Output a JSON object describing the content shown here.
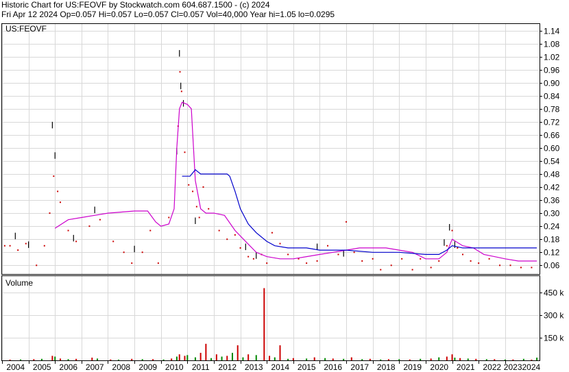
{
  "header": {
    "line1": "Historic Chart for US:FEOVF by Stockwatch.com 604.687.1500 - (c) 2024",
    "line2": "Fri Apr 12 2024   Op=0.057  Hi=0.057  Lo=0.057  Cl=0.057  Vol=40,000  Year hi=1.05  lo=0.0295"
  },
  "chart_data": [
    {
      "type": "line",
      "title": "US:FEOVF",
      "ylim": [
        0.02,
        1.17
      ],
      "y_ticks": [
        "1.14",
        "1.08",
        "1.02",
        "0.96",
        "0.90",
        "0.84",
        "0.78",
        "0.72",
        "0.66",
        "0.60",
        "0.54",
        "0.48",
        "0.42",
        "0.36",
        "0.30",
        "0.24",
        "0.18",
        "0.12",
        "0.06"
      ],
      "y_tick_values": [
        1.14,
        1.08,
        1.02,
        0.96,
        0.9,
        0.84,
        0.78,
        0.72,
        0.66,
        0.6,
        0.54,
        0.48,
        0.42,
        0.36,
        0.3,
        0.24,
        0.18,
        0.12,
        0.06
      ],
      "x_ticks": [
        "2004",
        "2005",
        "2006",
        "2007",
        "2008",
        "2009",
        "2010",
        "2011",
        "2012",
        "2013",
        "2014",
        "2015",
        "2016",
        "2017",
        "2018",
        "2019",
        "2020",
        "2021",
        "2022",
        "20232024"
      ],
      "xlim": [
        2004.0,
        2024.3
      ],
      "grid": true,
      "series": [
        {
          "color": "#000000",
          "style": "hi-lo bars",
          "points": [
            [
              2004.5,
              0.21
            ],
            [
              2005.0,
              0.17
            ],
            [
              2005.9,
              0.72
            ],
            [
              2006.0,
              0.58
            ],
            [
              2006.7,
              0.2
            ],
            [
              2007.5,
              0.33
            ],
            [
              2009.0,
              0.15
            ],
            [
              2010.6,
              0.6
            ],
            [
              2010.7,
              1.05
            ],
            [
              2010.75,
              0.9
            ],
            [
              2010.85,
              0.82
            ],
            [
              2011.3,
              0.28
            ],
            [
              2013.2,
              0.16
            ],
            [
              2013.6,
              0.12
            ],
            [
              2015.9,
              0.16
            ],
            [
              2016.9,
              0.13
            ],
            [
              2020.7,
              0.18
            ],
            [
              2020.9,
              0.25
            ],
            [
              2021.1,
              0.17
            ]
          ]
        },
        {
          "color": "#cc0000",
          "style": "close dots",
          "points": [
            [
              2004.1,
              0.15
            ],
            [
              2004.3,
              0.15
            ],
            [
              2004.6,
              0.13
            ],
            [
              2004.9,
              0.16
            ],
            [
              2005.3,
              0.06
            ],
            [
              2005.6,
              0.15
            ],
            [
              2005.8,
              0.3
            ],
            [
              2005.95,
              0.47
            ],
            [
              2006.1,
              0.4
            ],
            [
              2006.2,
              0.35
            ],
            [
              2006.5,
              0.22
            ],
            [
              2006.8,
              0.17
            ],
            [
              2007.3,
              0.24
            ],
            [
              2007.7,
              0.27
            ],
            [
              2008.2,
              0.17
            ],
            [
              2008.6,
              0.12
            ],
            [
              2008.9,
              0.07
            ],
            [
              2009.3,
              0.12
            ],
            [
              2009.6,
              0.22
            ],
            [
              2009.9,
              0.07
            ],
            [
              2010.3,
              0.28
            ],
            [
              2010.65,
              0.7
            ],
            [
              2010.72,
              0.95
            ],
            [
              2010.78,
              0.86
            ],
            [
              2010.9,
              0.58
            ],
            [
              2011.05,
              0.43
            ],
            [
              2011.2,
              0.4
            ],
            [
              2011.35,
              0.33
            ],
            [
              2011.45,
              0.28
            ],
            [
              2011.6,
              0.42
            ],
            [
              2011.8,
              0.32
            ],
            [
              2012.2,
              0.22
            ],
            [
              2012.5,
              0.18
            ],
            [
              2012.8,
              0.2
            ],
            [
              2013.0,
              0.14
            ],
            [
              2013.3,
              0.1
            ],
            [
              2013.5,
              0.09
            ],
            [
              2013.8,
              0.11
            ],
            [
              2014.0,
              0.07
            ],
            [
              2014.2,
              0.21
            ],
            [
              2014.5,
              0.16
            ],
            [
              2014.8,
              0.11
            ],
            [
              2015.2,
              0.09
            ],
            [
              2015.5,
              0.07
            ],
            [
              2015.9,
              0.08
            ],
            [
              2016.3,
              0.15
            ],
            [
              2016.7,
              0.11
            ],
            [
              2017.0,
              0.26
            ],
            [
              2017.3,
              0.12
            ],
            [
              2017.6,
              0.08
            ],
            [
              2018.0,
              0.09
            ],
            [
              2018.3,
              0.04
            ],
            [
              2018.7,
              0.06
            ],
            [
              2019.1,
              0.09
            ],
            [
              2019.5,
              0.04
            ],
            [
              2019.8,
              0.09
            ],
            [
              2020.2,
              0.05
            ],
            [
              2020.5,
              0.08
            ],
            [
              2020.8,
              0.15
            ],
            [
              2021.0,
              0.22
            ],
            [
              2021.2,
              0.14
            ],
            [
              2021.4,
              0.11
            ],
            [
              2021.7,
              0.08
            ],
            [
              2022.0,
              0.07
            ],
            [
              2022.4,
              0.09
            ],
            [
              2022.8,
              0.06
            ],
            [
              2023.2,
              0.06
            ],
            [
              2023.6,
              0.05
            ],
            [
              2024.0,
              0.05
            ]
          ]
        },
        {
          "color": "#cc00cc",
          "style": "line",
          "points": [
            [
              2006.0,
              0.23
            ],
            [
              2006.5,
              0.27
            ],
            [
              2007.0,
              0.28
            ],
            [
              2007.5,
              0.29
            ],
            [
              2008.0,
              0.3
            ],
            [
              2009.0,
              0.31
            ],
            [
              2009.5,
              0.31
            ],
            [
              2009.8,
              0.26
            ],
            [
              2010.0,
              0.24
            ],
            [
              2010.3,
              0.25
            ],
            [
              2010.5,
              0.32
            ],
            [
              2010.6,
              0.6
            ],
            [
              2010.7,
              0.78
            ],
            [
              2010.8,
              0.81
            ],
            [
              2011.0,
              0.8
            ],
            [
              2011.15,
              0.78
            ],
            [
              2011.3,
              0.45
            ],
            [
              2011.5,
              0.32
            ],
            [
              2011.7,
              0.3
            ],
            [
              2012.0,
              0.3
            ],
            [
              2012.4,
              0.29
            ],
            [
              2012.8,
              0.22
            ],
            [
              2013.2,
              0.17
            ],
            [
              2013.6,
              0.12
            ],
            [
              2014.0,
              0.1
            ],
            [
              2014.5,
              0.09
            ],
            [
              2015.0,
              0.09
            ],
            [
              2015.5,
              0.1
            ],
            [
              2016.0,
              0.11
            ],
            [
              2016.5,
              0.12
            ],
            [
              2017.0,
              0.13
            ],
            [
              2017.5,
              0.14
            ],
            [
              2018.0,
              0.14
            ],
            [
              2018.5,
              0.14
            ],
            [
              2019.0,
              0.13
            ],
            [
              2019.5,
              0.12
            ],
            [
              2020.0,
              0.09
            ],
            [
              2020.5,
              0.09
            ],
            [
              2020.8,
              0.12
            ],
            [
              2021.0,
              0.18
            ],
            [
              2021.4,
              0.15
            ],
            [
              2021.8,
              0.14
            ],
            [
              2022.2,
              0.11
            ],
            [
              2022.6,
              0.1
            ],
            [
              2023.0,
              0.09
            ],
            [
              2023.5,
              0.08
            ],
            [
              2024.2,
              0.08
            ]
          ]
        },
        {
          "color": "#0000cc",
          "style": "line",
          "points": [
            [
              2010.8,
              0.47
            ],
            [
              2011.1,
              0.47
            ],
            [
              2011.3,
              0.5
            ],
            [
              2011.5,
              0.48
            ],
            [
              2012.0,
              0.48
            ],
            [
              2012.5,
              0.48
            ],
            [
              2012.6,
              0.47
            ],
            [
              2012.8,
              0.4
            ],
            [
              2013.0,
              0.32
            ],
            [
              2013.3,
              0.25
            ],
            [
              2013.6,
              0.21
            ],
            [
              2014.0,
              0.17
            ],
            [
              2014.3,
              0.15
            ],
            [
              2014.8,
              0.14
            ],
            [
              2015.5,
              0.14
            ],
            [
              2016.0,
              0.13
            ],
            [
              2017.0,
              0.13
            ],
            [
              2018.0,
              0.12
            ],
            [
              2019.0,
              0.12
            ],
            [
              2020.0,
              0.11
            ],
            [
              2020.5,
              0.11
            ],
            [
              2020.8,
              0.13
            ],
            [
              2021.0,
              0.15
            ],
            [
              2021.4,
              0.14
            ],
            [
              2022.0,
              0.14
            ],
            [
              2023.0,
              0.14
            ],
            [
              2024.2,
              0.14
            ]
          ]
        }
      ]
    },
    {
      "type": "bar",
      "title": "Volume",
      "ylim": [
        0,
        560
      ],
      "y_ticks": [
        "450 k",
        "300 k",
        "150 k"
      ],
      "y_tick_values": [
        450,
        300,
        150
      ],
      "units": "k",
      "series": [
        {
          "color": "#cc0000",
          "points": [
            [
              2004.3,
              5
            ],
            [
              2005.2,
              8
            ],
            [
              2005.9,
              30
            ],
            [
              2006.2,
              12
            ],
            [
              2006.8,
              10
            ],
            [
              2007.4,
              18
            ],
            [
              2008.1,
              6
            ],
            [
              2008.9,
              10
            ],
            [
              2009.7,
              8
            ],
            [
              2010.4,
              12
            ],
            [
              2010.7,
              40
            ],
            [
              2010.9,
              30
            ],
            [
              2011.5,
              50
            ],
            [
              2011.7,
              110
            ],
            [
              2012.1,
              40
            ],
            [
              2012.5,
              30
            ],
            [
              2012.9,
              100
            ],
            [
              2013.3,
              40
            ],
            [
              2013.9,
              480
            ],
            [
              2014.1,
              30
            ],
            [
              2014.5,
              100
            ],
            [
              2015.0,
              15
            ],
            [
              2015.8,
              20
            ],
            [
              2016.5,
              12
            ],
            [
              2017.2,
              20
            ],
            [
              2017.9,
              10
            ],
            [
              2018.6,
              8
            ],
            [
              2019.4,
              6
            ],
            [
              2020.2,
              12
            ],
            [
              2020.8,
              25
            ],
            [
              2021.0,
              40
            ],
            [
              2021.3,
              15
            ],
            [
              2021.9,
              10
            ],
            [
              2022.6,
              8
            ],
            [
              2023.3,
              6
            ],
            [
              2024.0,
              5
            ]
          ]
        },
        {
          "color": "#008800",
          "points": [
            [
              2004.7,
              6
            ],
            [
              2005.5,
              10
            ],
            [
              2006.0,
              25
            ],
            [
              2006.5,
              8
            ],
            [
              2007.6,
              12
            ],
            [
              2008.4,
              5
            ],
            [
              2009.3,
              8
            ],
            [
              2010.1,
              6
            ],
            [
              2010.6,
              25
            ],
            [
              2011.0,
              35
            ],
            [
              2011.3,
              20
            ],
            [
              2011.9,
              15
            ],
            [
              2012.3,
              25
            ],
            [
              2012.7,
              50
            ],
            [
              2013.1,
              20
            ],
            [
              2013.6,
              35
            ],
            [
              2014.3,
              20
            ],
            [
              2014.8,
              10
            ],
            [
              2015.5,
              12
            ],
            [
              2016.2,
              15
            ],
            [
              2016.9,
              10
            ],
            [
              2017.6,
              8
            ],
            [
              2018.3,
              6
            ],
            [
              2019.0,
              8
            ],
            [
              2019.8,
              10
            ],
            [
              2020.5,
              20
            ],
            [
              2021.1,
              18
            ],
            [
              2021.6,
              12
            ],
            [
              2022.3,
              8
            ],
            [
              2023.0,
              6
            ],
            [
              2023.7,
              10
            ],
            [
              2024.2,
              18
            ]
          ]
        }
      ]
    }
  ]
}
